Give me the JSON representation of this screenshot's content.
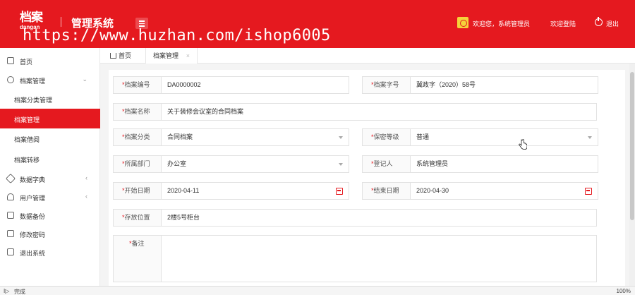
{
  "header": {
    "logo_text": "档案",
    "logo_sub": "dangan",
    "app_title": "管理系统",
    "watermark": "https://www.huzhan.com/ishop6005",
    "welcome": "欢迎您，系统管理员",
    "relogin": "欢迎登陆",
    "logout": "退出"
  },
  "sidebar": {
    "items": [
      {
        "label": "首页",
        "icon": "home-icon"
      },
      {
        "label": "档案管理",
        "icon": "key-icon",
        "arrow": "⌄"
      },
      {
        "label": "档案分类管理"
      },
      {
        "label": "档案管理"
      },
      {
        "label": "档案借阅"
      },
      {
        "label": "档案转移"
      },
      {
        "label": "数据字典",
        "icon": "tag-icon",
        "arrow": "‹"
      },
      {
        "label": "用户管理",
        "icon": "user-icon",
        "arrow": "‹"
      },
      {
        "label": "数据备份",
        "icon": "backup-icon"
      },
      {
        "label": "修改密码",
        "icon": "password-icon"
      },
      {
        "label": "退出系统",
        "icon": "exit-icon"
      }
    ]
  },
  "tabs": {
    "home": "首页",
    "active": "档案管理",
    "close": "×"
  },
  "form": {
    "archive_no": {
      "label": "档案编号",
      "value": "DA0000002"
    },
    "archive_word": {
      "label": "档案字号",
      "value": "冀政字（2020）58号"
    },
    "archive_name": {
      "label": "档案名称",
      "value": "关于装修会议室的合同档案"
    },
    "category": {
      "label": "档案分类",
      "value": "合同档案"
    },
    "secret_level": {
      "label": "保密等级",
      "value": "普通"
    },
    "department": {
      "label": "所属部门",
      "value": "办公室"
    },
    "registrant": {
      "label": "登记人",
      "value": "系统管理员"
    },
    "start_date": {
      "label": "开始日期",
      "value": "2020-04-11"
    },
    "end_date": {
      "label": "结束日期",
      "value": "2020-04-30"
    },
    "location": {
      "label": "存放位置",
      "value": "2楼5号柜台"
    },
    "remark": {
      "label": "备注",
      "value": ""
    },
    "required_mark": "*"
  },
  "statusbar": {
    "status": "完成",
    "zoom": "100%"
  },
  "colors": {
    "primary": "#e5191f",
    "background": "#f4f4f4"
  }
}
